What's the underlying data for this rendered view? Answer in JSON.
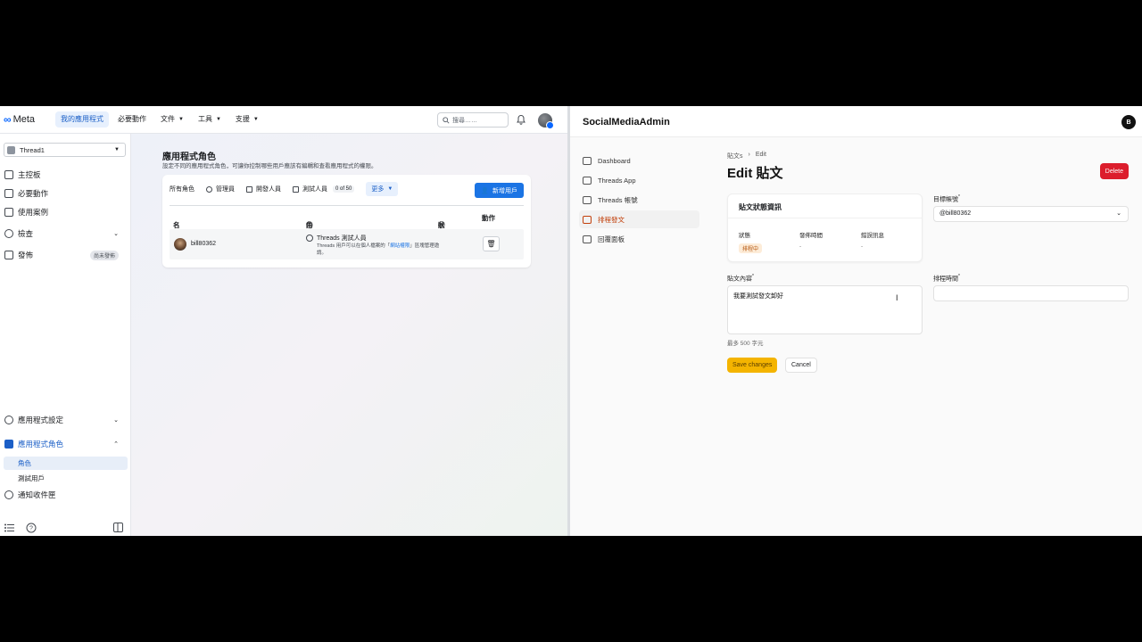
{
  "meta": {
    "logo": "Meta",
    "nav": [
      {
        "label": "我的應用程式"
      },
      {
        "label": "必要動作"
      },
      {
        "label": "文件"
      },
      {
        "label": "工具"
      },
      {
        "label": "支援"
      }
    ],
    "search_placeholder": "搜尋……",
    "app_selector": "Thread1",
    "sidebar": {
      "items": [
        "主控板",
        "必要動作",
        "使用案例",
        "檢查",
        "發佈"
      ],
      "publish_badge": "尚未發佈",
      "settings": "應用程式設定",
      "roles_group": "應用程式角色",
      "roles_sub": [
        "角色",
        "測試用戶"
      ],
      "webhooks": "通知收件匣"
    },
    "main": {
      "title": "應用程式角色",
      "description": "設定不同的應用程式角色，可讓你控制哪些用戶應該有編輯和查看應用程式的權限。",
      "tabs": [
        "所有角色",
        "管理員",
        "開發人員",
        "測試人員"
      ],
      "tester_count": "0 of 50",
      "more": "更多",
      "add_button": "新增用戶",
      "columns": [
        "名稱",
        "角色",
        "狀態",
        "動作"
      ],
      "rows": [
        {
          "name": "bill80362",
          "role": "Threads 測試人員",
          "role_desc_prefix": "Threads 用戶可以在個人檔案的「",
          "role_desc_link": "網站權限",
          "role_desc_suffix": "」區塊管理邀請。"
        }
      ]
    }
  },
  "sma": {
    "brand": "SocialMediaAdmin",
    "user_initial": "B",
    "nav": [
      "Dashboard",
      "Threads App",
      "Threads 帳號",
      "排程發文",
      "回覆面板"
    ],
    "breadcrumb": [
      "貼文s",
      "Edit"
    ],
    "title": "Edit 貼文",
    "delete": "Delete",
    "status_card": {
      "heading": "貼文狀態資訊",
      "cols": [
        {
          "label": "狀態",
          "value": "排程中"
        },
        {
          "label": "發佈時間",
          "value": "-"
        },
        {
          "label": "錯誤訊息",
          "value": "-"
        }
      ]
    },
    "target_account_label": "目標帳號",
    "target_account_value": "@bill80362",
    "content_label": "貼文內容",
    "content_value": "我要測試發文卸好",
    "content_hint": "最多 500 字元",
    "schedule_label": "排程時間",
    "save": "Save changes",
    "cancel": "Cancel"
  },
  "colors": {
    "meta_blue": "#1b74e4",
    "sma_accent": "#c2410c",
    "delete_red": "#dc1d2c",
    "save_yellow": "#f4b400"
  }
}
